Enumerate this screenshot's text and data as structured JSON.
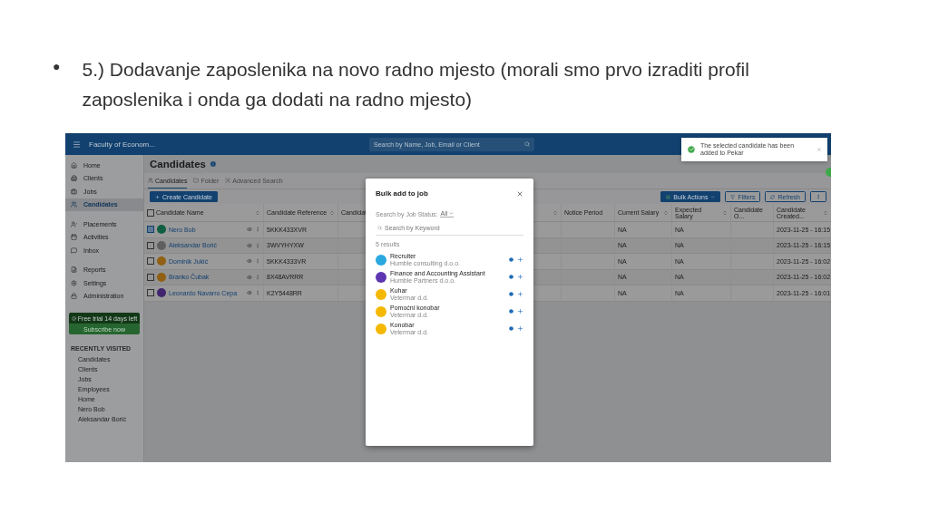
{
  "slide": {
    "bullet": "●",
    "text": "5.) Dodavanje zaposlenika na novo radno mjesto (morali smo prvo izraditi profil zaposlenika i onda ga dodati na radno mjesto)"
  },
  "topbar": {
    "title": "Faculty of Econom...",
    "search_placeholder": "Search by Name, Job, Email or Client"
  },
  "sidebar": {
    "sections": [
      {
        "items": [
          {
            "label": "Home",
            "selected": false
          },
          {
            "label": "Clients",
            "selected": false
          },
          {
            "label": "Jobs",
            "selected": false
          },
          {
            "label": "Candidates",
            "selected": true
          }
        ]
      },
      {
        "items": [
          {
            "label": "Placements",
            "selected": false
          },
          {
            "label": "Activities",
            "selected": false
          },
          {
            "label": "Inbox",
            "selected": false
          }
        ]
      },
      {
        "items": [
          {
            "label": "Reports",
            "selected": false
          },
          {
            "label": "Settings",
            "selected": false
          },
          {
            "label": "Administration",
            "selected": false
          }
        ]
      }
    ],
    "trial": {
      "text": "Free trial 14 days left",
      "button": "Subscribe now"
    },
    "recent_heading": "RECENTLY VISITED",
    "recent": [
      "Candidates",
      "Clients",
      "Jobs",
      "Employees",
      "Home",
      "Nero Bob",
      "Aleksandar Borić"
    ]
  },
  "page": {
    "title": "Candidates",
    "tabs": [
      {
        "label": "Candidates",
        "selected": true
      },
      {
        "label": "Folder",
        "selected": false
      },
      {
        "label": "Advanced Search",
        "selected": false
      }
    ],
    "create_button": "Create Candidate",
    "bulk_button": "Bulk Actions",
    "filters_button": "Filters",
    "refresh_button": "Refresh"
  },
  "table": {
    "all_selected": false,
    "columns": [
      {
        "label": "Candidate Name",
        "sortable": true
      },
      {
        "label": "Candidate Reference",
        "sortable": true
      },
      {
        "label": "Candidat"
      },
      {
        "sortable": true
      },
      {
        "label": "Notice Period",
        "sortable": false
      },
      {
        "label": "Current Salary",
        "sortable": true
      },
      {
        "label": "Expected Salary",
        "sortable": true
      },
      {
        "label": "Candidate O...",
        "sortable": false
      },
      {
        "label": "Candidate Created...",
        "sortable": true
      }
    ],
    "rows": [
      {
        "selected": true,
        "name": "Nero Bob",
        "color": "#105f42",
        "reference": "5KKK433XVR",
        "current_salary": "NA",
        "expected_salary": "NA",
        "created": "2023-11-25 - 16:15"
      },
      {
        "selected": false,
        "name": "Aleksandar Borić",
        "color": "#5f5f5f",
        "reference": "3WVYHYXW",
        "current_salary": "NA",
        "expected_salary": "NA",
        "created": "2023-11-25 - 16:15"
      },
      {
        "selected": false,
        "name": "Dominik Jukić",
        "color": "#906013",
        "reference": "5KKK4333VR",
        "current_salary": "NA",
        "expected_salary": "NA",
        "created": "2023-11-25 - 16:02"
      },
      {
        "selected": false,
        "name": "Branko Čubak",
        "color": "#906013",
        "reference": "8X48AVRRR",
        "current_salary": "NA",
        "expected_salary": "NA",
        "created": "2023-11-25 - 16:02"
      },
      {
        "selected": false,
        "name": "Leonardo Navarro Cepa",
        "color": "#40256e",
        "reference": "K2Y5448RR",
        "current_salary": "NA",
        "expected_salary": "NA",
        "created": "2023-11-25 - 16:01"
      }
    ]
  },
  "modal": {
    "title": "Bulk add to job",
    "status_label": "Search by Job Status:",
    "status_value": "All",
    "keyword_placeholder": "Search by Keyword",
    "results": "5 results",
    "jobs": [
      {
        "title": "Recruiter",
        "company": "Humble consulting d.o.o.",
        "color": "#29a8e0"
      },
      {
        "title": "Finance and Accounting Assistant",
        "company": "Humble Partners d.o.o.",
        "color": "#5e35b1"
      },
      {
        "title": "Kuhar",
        "company": "Vetermar d.d.",
        "color": "#f5b800"
      },
      {
        "title": "Pomoćni konobar",
        "company": "Vetermar d.d.",
        "color": "#f5b800"
      },
      {
        "title": "Konobar",
        "company": "Vetermar d.d.",
        "color": "#f5b800"
      }
    ]
  },
  "toast": {
    "text": "The selected candidate has been added to Pekar"
  }
}
